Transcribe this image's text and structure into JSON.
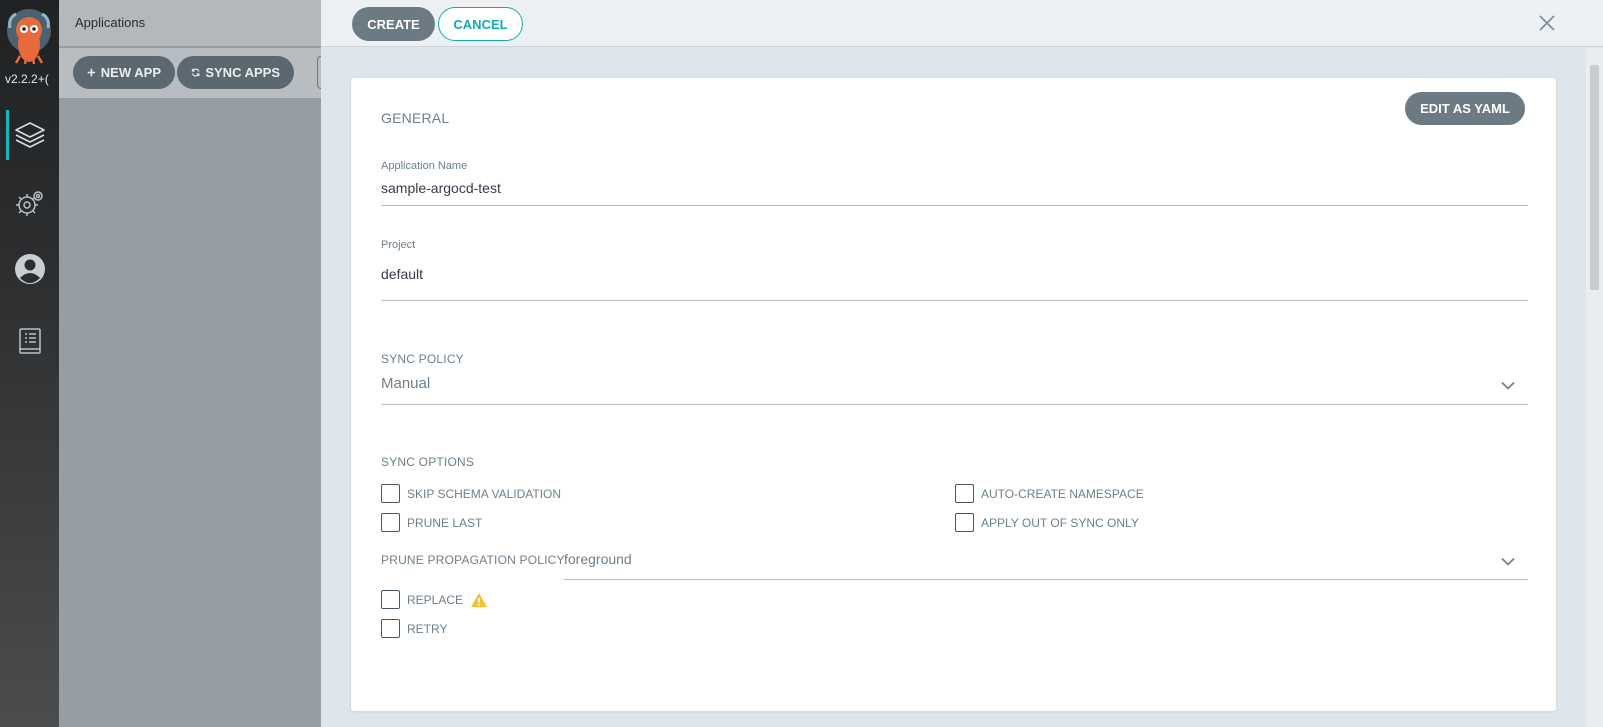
{
  "nav": {
    "version": "v2.2.2+(",
    "items": [
      {
        "icon": "layers-icon",
        "active": true
      },
      {
        "icon": "settings-gear-icon",
        "active": false
      },
      {
        "icon": "user-icon",
        "active": false
      },
      {
        "icon": "docs-icon",
        "active": false
      }
    ]
  },
  "apps": {
    "title": "Applications",
    "new_app": "NEW APP",
    "sync_apps": "SYNC APPS"
  },
  "panel": {
    "create": "CREATE",
    "cancel": "CANCEL",
    "edit_yaml": "EDIT AS YAML",
    "general": "GENERAL",
    "app_name_label": "Application Name",
    "app_name_value": "sample-argocd-test",
    "project_label": "Project",
    "project_value": "default",
    "sync_policy_label": "SYNC POLICY",
    "sync_policy_value": "Manual",
    "sync_options_label": "SYNC OPTIONS",
    "options": {
      "skip_schema": "SKIP SCHEMA VALIDATION",
      "auto_ns": "AUTO-CREATE NAMESPACE",
      "prune_last": "PRUNE LAST",
      "apply_oos": "APPLY OUT OF SYNC ONLY",
      "replace": "REPLACE",
      "retry": "RETRY"
    },
    "prune_policy_label": "PRUNE PROPAGATION POLICY:",
    "prune_policy_value": "foreground"
  },
  "colors": {
    "accent": "#16aab5",
    "button": "#6c7a84",
    "warning": "#f4c030"
  }
}
